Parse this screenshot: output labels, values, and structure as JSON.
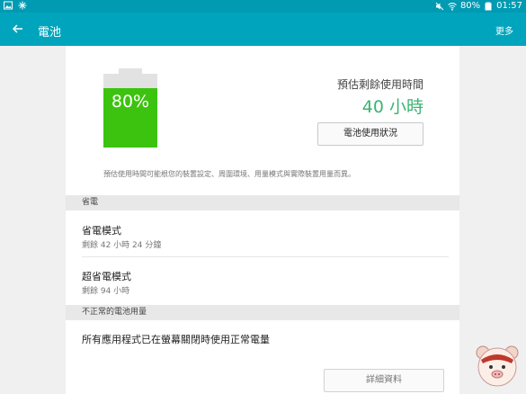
{
  "statusbar": {
    "battery": "80%",
    "time": "01:57"
  },
  "appbar": {
    "title": "電池",
    "more": "更多"
  },
  "battery": {
    "level_percent": 80,
    "label": "80%"
  },
  "estimate": {
    "label": "預估剩餘使用時間",
    "value": "40 小時"
  },
  "usage_button": "電池使用狀況",
  "disclaimer": "預估使用時間可能根您的裝置設定、周圍環境、用量模式與實際裝置用量而異。",
  "power_saving": {
    "header": "省電",
    "items": [
      {
        "title": "省電模式",
        "subtitle": "剩餘 42 小時 24 分鐘"
      },
      {
        "title": "超省電模式",
        "subtitle": "剩餘 94 小時"
      }
    ]
  },
  "abnormal": {
    "header": "不正常的電池用量",
    "message": "所有應用程式已在螢幕關閉時使用正常電量"
  },
  "details_button": "詳細資料"
}
